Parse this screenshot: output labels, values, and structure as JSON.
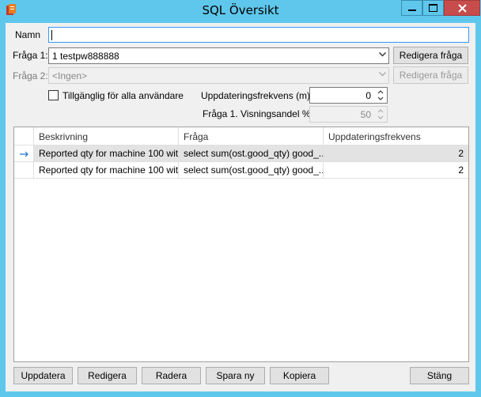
{
  "window": {
    "title": "SQL Översikt"
  },
  "form": {
    "namn_label": "Namn",
    "namn_value": "",
    "fraga1_label": "Fråga 1:",
    "fraga1_value": "1 testpw888888",
    "redigera_fraga_1": "Redigera fråga",
    "fraga2_label": "Fråga 2:",
    "fraga2_value": "<Ingen>",
    "redigera_fraga_2": "Redigera fråga",
    "tillganglig_label": "Tillgänglig för alla användare",
    "uppdateringsfrekvens_label": "Uppdateringsfrekvens (m)",
    "uppdateringsfrekvens_value": "0",
    "visningsandel_label": "Fråga 1. Visningsandel %",
    "visningsandel_value": "50"
  },
  "grid": {
    "columns": [
      "Beskrivning",
      "Fråga",
      "Uppdateringsfrekvens"
    ],
    "rows": [
      {
        "beskrivning": "Reported qty for machine 100 wit...",
        "fraga": "select sum(ost.good_qty) good_...",
        "frekvens": "2",
        "selected": true
      },
      {
        "beskrivning": "Reported qty for machine 100 wit...",
        "fraga": "select sum(ost.good_qty) good_...",
        "frekvens": "2",
        "selected": false
      }
    ]
  },
  "buttons": {
    "uppdatera": "Uppdatera",
    "redigera": "Redigera",
    "radera": "Radera",
    "spara_ny": "Spara ny",
    "kopiera": "Kopiera",
    "stang": "Stäng"
  },
  "icons": {
    "app": "app-icon",
    "minimize": "minimize-icon",
    "maximize": "maximize-icon",
    "close": "close-icon",
    "row_pointer": "arrow-right-icon"
  },
  "colors": {
    "frame": "#5fc7ec",
    "close_button": "#c74c4c",
    "selected_row": "#e3e3e3",
    "focus_border": "#3399ff"
  }
}
